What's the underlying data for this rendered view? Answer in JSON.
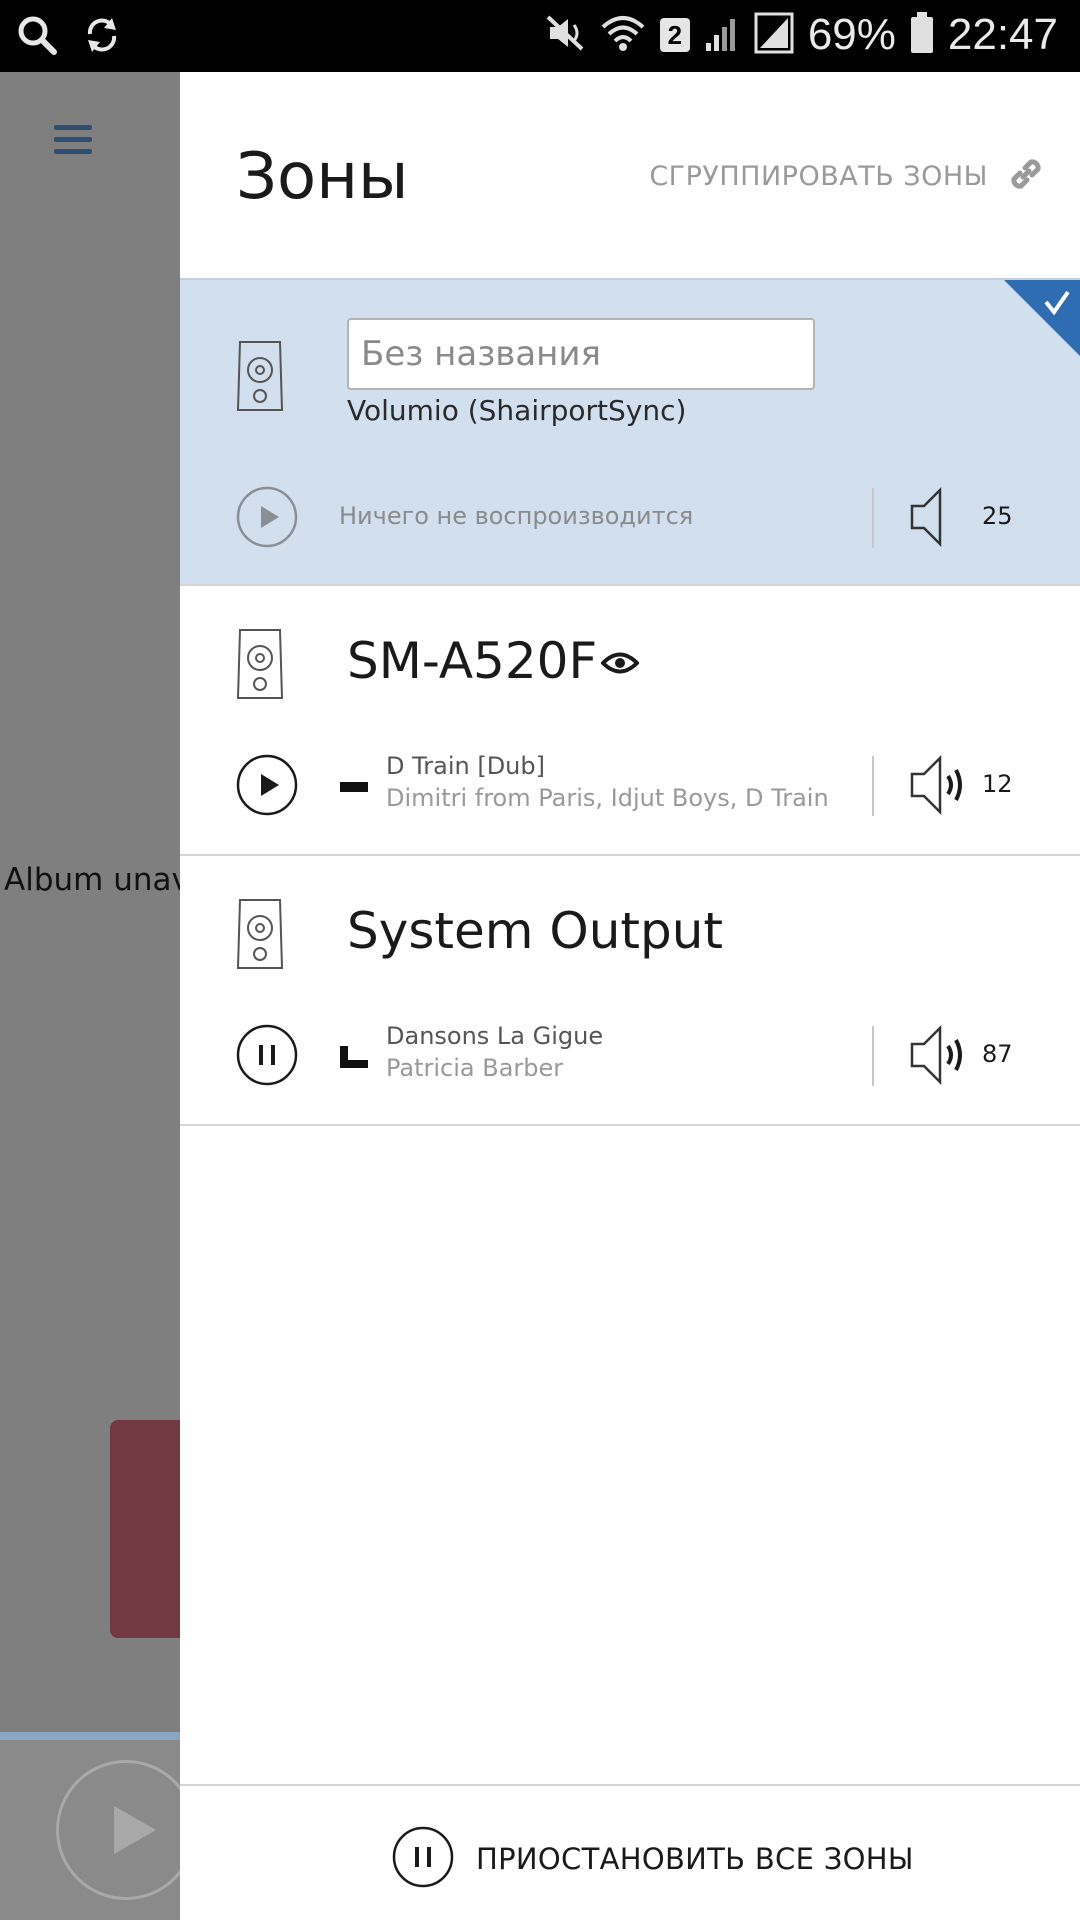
{
  "status_bar": {
    "battery": "69%",
    "time": "22:47",
    "sim_badge": "2",
    "icons": [
      "search-icon",
      "sync-icon",
      "mute-icon",
      "wifi-icon",
      "signal-icon",
      "battery-icon"
    ]
  },
  "background": {
    "album_text": "Album unav"
  },
  "drawer": {
    "title": "Зоны",
    "group_label": "СГРУППИРОВАТЬ ЗОНЫ"
  },
  "zones": [
    {
      "name_placeholder": "Без названия",
      "subtitle": "Volumio (ShairportSync)",
      "status": "Ничего не воспроизводится",
      "volume": "25",
      "selected": true
    },
    {
      "name": "SM-A520F",
      "track_title": "D Train [Dub]",
      "track_artist": "Dimitri from Paris, Idjut Boys, D Train",
      "volume": "12",
      "state": "paused"
    },
    {
      "name": "System Output",
      "track_title": "Dansons La Gigue",
      "track_artist": "Patricia Barber",
      "volume": "87",
      "state": "playing"
    }
  ],
  "footer": {
    "pause_all_label": "ПРИОСТАНОВИТЬ ВСЕ ЗОНЫ"
  },
  "colors": {
    "accent": "#2f6db3",
    "selected_zone_bg": "#d2dfee"
  }
}
